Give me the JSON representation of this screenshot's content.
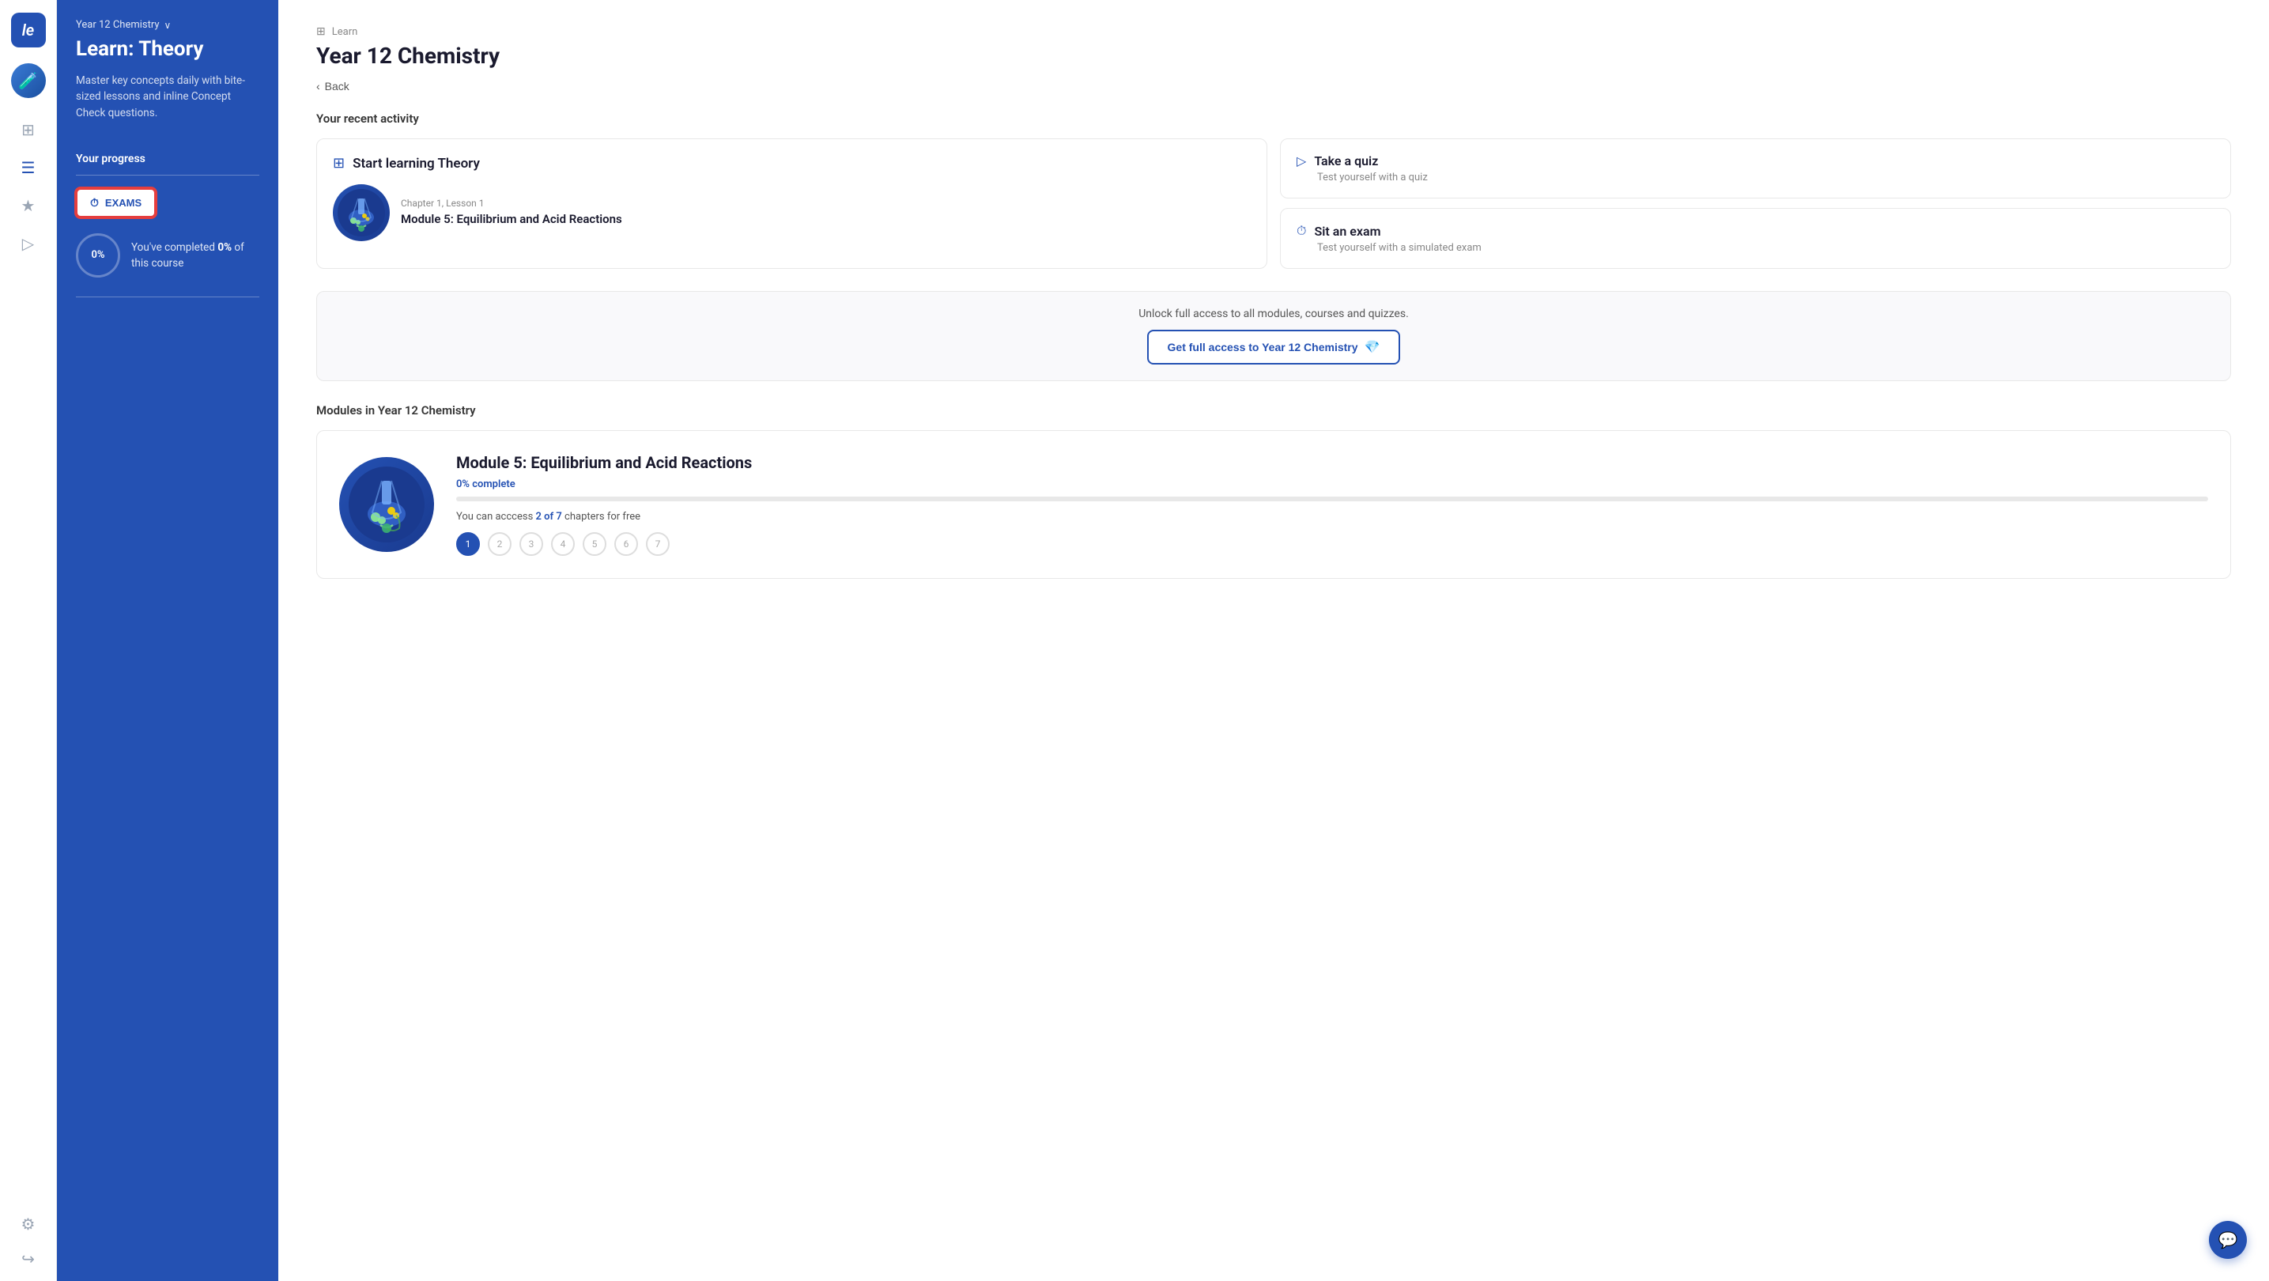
{
  "app": {
    "logo_text": "le",
    "avatar_emoji": "🧪"
  },
  "sidebar": {
    "course_name": "Year 12 Chemistry",
    "title": "Learn: Theory",
    "description": "Master key concepts daily with bite-sized lessons and inline Concept Check questions.",
    "progress_label": "Your progress",
    "progress_percent": "0%",
    "progress_text": "You've completed",
    "progress_bold": "0%",
    "progress_suffix": "of this course",
    "exams_button_label": "EXAMS"
  },
  "header": {
    "breadcrumb_icon": "⊞",
    "breadcrumb_text": "Learn",
    "page_title": "Year 12 Chemistry",
    "back_label": "Back"
  },
  "recent_activity": {
    "label": "Your recent activity",
    "start_card": {
      "icon": "⊞",
      "title": "Start learning Theory",
      "chapter": "Chapter 1, Lesson 1",
      "module": "Module 5: Equilibrium and Acid Reactions"
    },
    "quiz_card": {
      "icon": "▷",
      "title": "Take a quiz",
      "description": "Test yourself with a quiz"
    },
    "exam_card": {
      "icon": "⏱",
      "title": "Sit an exam",
      "description": "Test yourself with a simulated exam"
    }
  },
  "unlock": {
    "text": "Unlock full access to all modules, courses and quizzes.",
    "button_label": "Get full access to Year 12 Chemistry",
    "diamond_icon": "💎"
  },
  "modules": {
    "section_label": "Modules in Year 12 Chemistry",
    "module_title": "Module 5: Equilibrium and Acid Reactions",
    "complete_text": "0% complete",
    "access_text": "You can acccess",
    "access_highlight": "2 of 7",
    "access_suffix": "chapters for free",
    "chapters": [
      "1",
      "2",
      "3",
      "4",
      "5",
      "6",
      "7"
    ],
    "active_chapter": 0
  },
  "chat": {
    "icon": "💬"
  }
}
